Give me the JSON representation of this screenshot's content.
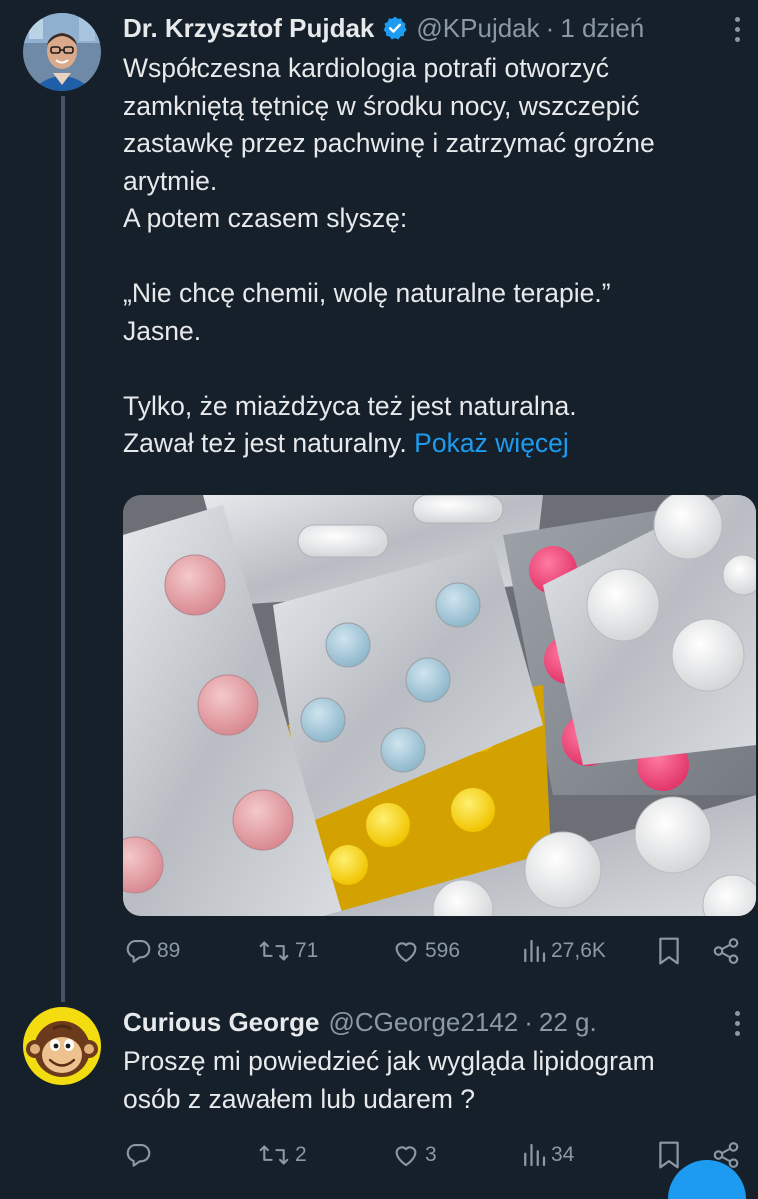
{
  "colors": {
    "background": "#15202b",
    "text_primary": "#e7e9ea",
    "text_secondary": "#8b98a5",
    "accent": "#1d9bf0",
    "thread_line": "#425466"
  },
  "tweet": {
    "author": {
      "name": "Dr. Krzysztof Pujdak",
      "handle": "@KPujdak",
      "verified_icon": "verified-badge-icon"
    },
    "separator": "·",
    "time": "1 dzień",
    "text_lines": [
      "Współczesna kardiologia potrafi otworzyć",
      "zamkniętą tętnicę w środku nocy, wszczepić",
      "zastawkę przez pachwinę i zatrzymać groźne",
      "arytmie.",
      "A potem czasem slyszę:",
      "",
      "„Nie chcę chemii, wolę naturalne terapie.”",
      "Jasne.",
      "",
      "Tylko, że miażdżyca też jest naturalna."
    ],
    "last_line_text": "Zawał też jest naturalny.",
    "show_more": "Pokaż więcej",
    "media_icon": "pill-blister-packs-photo",
    "stats": {
      "replies": "89",
      "reposts": "71",
      "likes": "596",
      "views": "27,6K"
    }
  },
  "reply": {
    "author": {
      "name": "Curious George",
      "handle": "@CGeorge2142"
    },
    "separator": "·",
    "time": "22 g.",
    "text_lines": [
      "Proszę mi powiedzieć jak wygląda lipidogram",
      "osób z zawałem lub udarem ?"
    ],
    "stats": {
      "replies": "",
      "reposts": "2",
      "likes": "3",
      "views": "34"
    }
  }
}
